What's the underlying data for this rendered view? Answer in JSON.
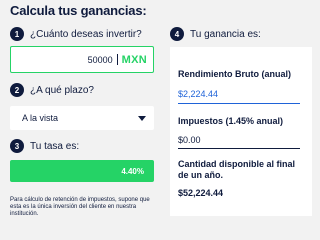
{
  "header": {
    "title": "Calcula tus ganancias:"
  },
  "steps": {
    "s1": {
      "number": "1",
      "label": "¿Cuánto deseas invertir?"
    },
    "s2": {
      "number": "2",
      "label": "¿A qué plazo?"
    },
    "s3": {
      "number": "3",
      "label": "Tu tasa es:"
    },
    "s4": {
      "number": "4",
      "label": "Tu ganancia es:"
    }
  },
  "amount_input": {
    "value": "50000",
    "currency": "MXN"
  },
  "term_select": {
    "selected": "A la vista"
  },
  "rate": {
    "value": "4.40%"
  },
  "disclaimer": "Para cálculo de retención de impuestos, supone que esta es la única inversión del cliente en nuestra institución.",
  "results": {
    "gross": {
      "label": "Rendimiento Bruto (anual)",
      "value": "$2,224.44"
    },
    "taxes": {
      "label": "Impuestos (1.45% anual)",
      "value": "$0.00"
    },
    "available": {
      "label": "Cantidad disponible al final de un año.",
      "value": "$52,224.44"
    }
  },
  "colors": {
    "navy": "#0f1b3d",
    "green": "#25d366",
    "blue": "#1f63d8",
    "background": "#f2f2f2"
  }
}
